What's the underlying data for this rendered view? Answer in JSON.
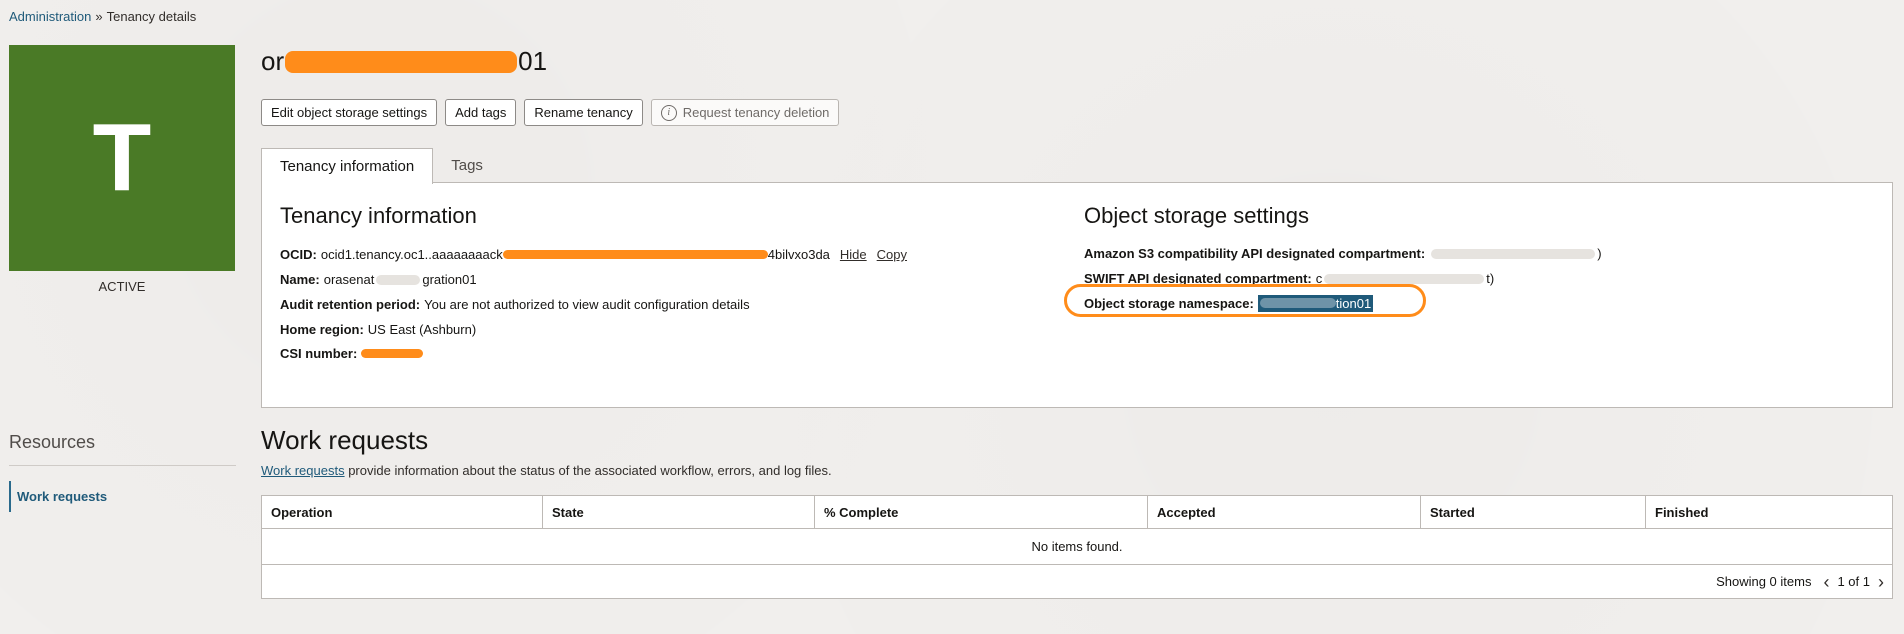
{
  "breadcrumb": {
    "parent": "Administration",
    "separator": "»",
    "current": "Tenancy details"
  },
  "tile": {
    "letter": "T",
    "status": "ACTIVE",
    "color": "#4a7a26"
  },
  "resources": {
    "title": "Resources",
    "items": [
      {
        "label": "Work requests"
      }
    ]
  },
  "header": {
    "title_prefix": "or",
    "title_suffix": "01"
  },
  "actions": {
    "edit_object_storage": "Edit object storage settings",
    "add_tags": "Add tags",
    "rename_tenancy": "Rename tenancy",
    "request_deletion": "Request tenancy deletion"
  },
  "tabs": [
    {
      "label": "Tenancy information"
    },
    {
      "label": "Tags"
    }
  ],
  "tenancy_info": {
    "heading": "Tenancy information",
    "ocid_label": "OCID:",
    "ocid_prefix": "ocid1.tenancy.oc1..aaaaaaaack",
    "ocid_suffix": "4bilvxo3da",
    "hide": "Hide",
    "copy": "Copy",
    "name_label": "Name:",
    "name_prefix": "orasenat",
    "name_suffix": "gration01",
    "audit_label": "Audit retention period:",
    "audit_value": "You are not authorized to view audit configuration details",
    "region_label": "Home region:",
    "region_value": "US East (Ashburn)",
    "csi_label": "CSI number:"
  },
  "object_storage": {
    "heading": "Object storage settings",
    "s3_label": "Amazon S3 compatibility API designated compartment:",
    "s3_suffix": ")",
    "swift_label": "SWIFT API designated compartment:",
    "swift_prefix": "c",
    "swift_suffix": "t)",
    "namespace_label": "Object storage namespace:",
    "namespace_suffix": "tion01"
  },
  "work_requests": {
    "title": "Work requests",
    "desc_link": "Work requests",
    "desc_rest": "provide information about the status of the associated workflow, errors, and log files.",
    "columns": [
      "Operation",
      "State",
      "% Complete",
      "Accepted",
      "Started",
      "Finished"
    ],
    "empty": "No items found.",
    "showing": "Showing 0 items",
    "page": "1 of 1"
  },
  "colors": {
    "accent": "#1f5a7a",
    "redaction": "#ff8c1a"
  }
}
